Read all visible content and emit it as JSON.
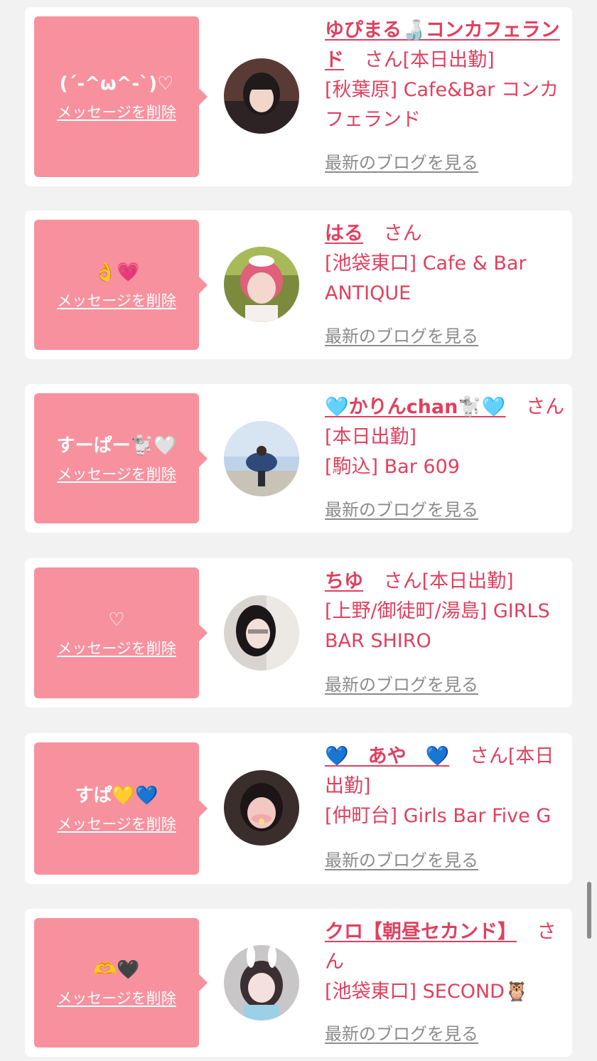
{
  "cards": [
    {
      "message": "(´-^ω^-`)♡",
      "delete_label": "メッセージを削除",
      "name": "ゆぴまる🍶コンカフェランド",
      "honorific": "さん[本日出勤]",
      "shop": "[秋葉原] Cafe&Bar コンカフェランド",
      "blog_label": "最新のブログを見る"
    },
    {
      "message": "👌💗",
      "delete_label": "メッセージを削除",
      "name": "はる",
      "honorific": "さん",
      "shop": "[池袋東口] Cafe & Bar ANTIQUE",
      "blog_label": "最新のブログを見る"
    },
    {
      "message": "すーぱー🐩🤍",
      "delete_label": "メッセージを削除",
      "name": "🩵かりんchan🐩🩵",
      "honorific": "さん[本日出勤]",
      "shop": "[駒込] Bar 609",
      "blog_label": "最新のブログを見る"
    },
    {
      "message": "♡",
      "delete_label": "メッセージを削除",
      "name": "ちゆ",
      "honorific": "さん[本日出勤]",
      "shop": "[上野/御徒町/湯島] GIRLS BAR SHIRO",
      "blog_label": "最新のブログを見る"
    },
    {
      "message": "すぱ💛💙",
      "delete_label": "メッセージを削除",
      "name": "💙　あや　💙",
      "honorific": "さん[本日出勤]",
      "shop": "[仲町台] Girls Bar Five G",
      "blog_label": "最新のブログを見る"
    },
    {
      "message": "🫶🖤",
      "delete_label": "メッセージを削除",
      "name": "クロ【朝昼セカンド】",
      "honorific": "さん",
      "shop": "[池袋東口] SECOND🦉",
      "blog_label": "最新のブログを見る"
    }
  ],
  "colors": {
    "bubble": "#f8919e",
    "accent": "#e0405f",
    "link_gray": "#8b8b8b",
    "background": "#f2f2f2"
  }
}
